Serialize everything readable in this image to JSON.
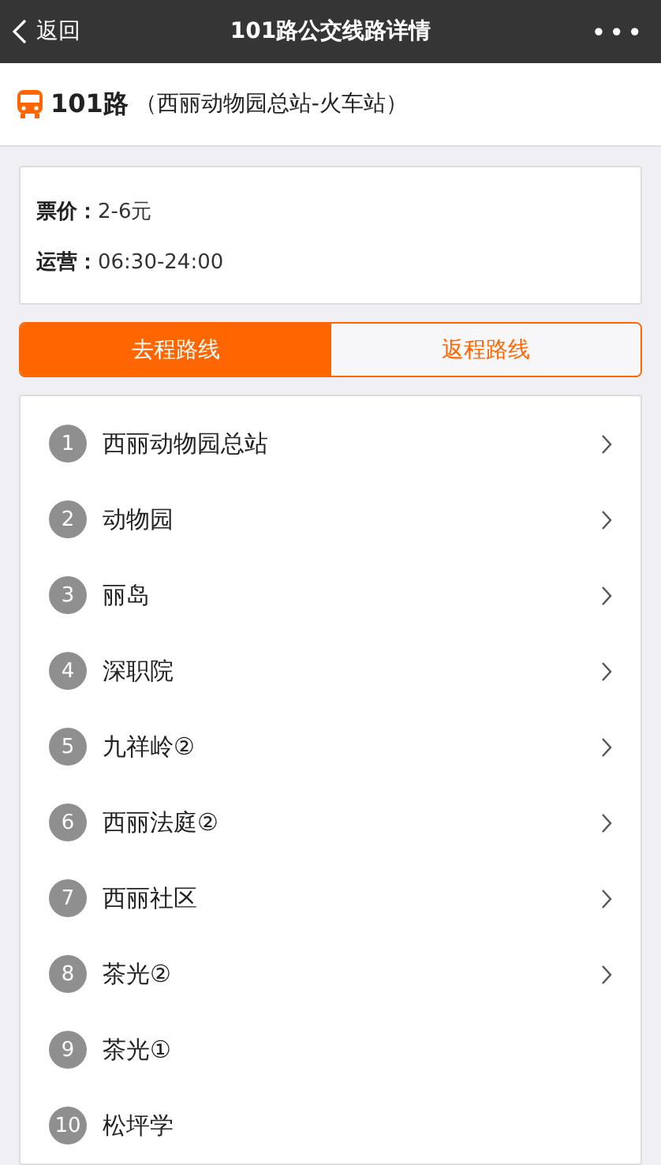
{
  "nav_bar": {
    "back_label": "返回",
    "title": "101路公交线路详情",
    "more": "•••"
  },
  "route": {
    "name": "101路",
    "terminals": "（西丽动物园总站-火车站）"
  },
  "info": [
    {
      "label": "票价：",
      "value": "2-6元"
    },
    {
      "label": "运营：",
      "value": "06:30-24:00"
    }
  ],
  "tabs": [
    {
      "label": "去程路线",
      "selected": true
    },
    {
      "label": "返程路线",
      "selected": false
    }
  ],
  "stops": [
    {
      "number": "1",
      "name": "西丽动物园总站",
      "chevron": true
    },
    {
      "number": "2",
      "name": "动物园",
      "chevron": true
    },
    {
      "number": "3",
      "name": "丽岛",
      "chevron": true
    },
    {
      "number": "4",
      "name": "深职院",
      "chevron": true
    },
    {
      "number": "5",
      "name": "九祥岭②",
      "chevron": true
    },
    {
      "number": "6",
      "name": "西丽法庭②",
      "chevron": true
    },
    {
      "number": "7",
      "name": "西丽社区",
      "chevron": true
    },
    {
      "number": "8",
      "name": "茶光②",
      "chevron": true
    },
    {
      "number": "9",
      "name": "茶光①",
      "chevron": false
    },
    {
      "number": "10",
      "name": "松坪学",
      "chevron": false
    }
  ]
}
